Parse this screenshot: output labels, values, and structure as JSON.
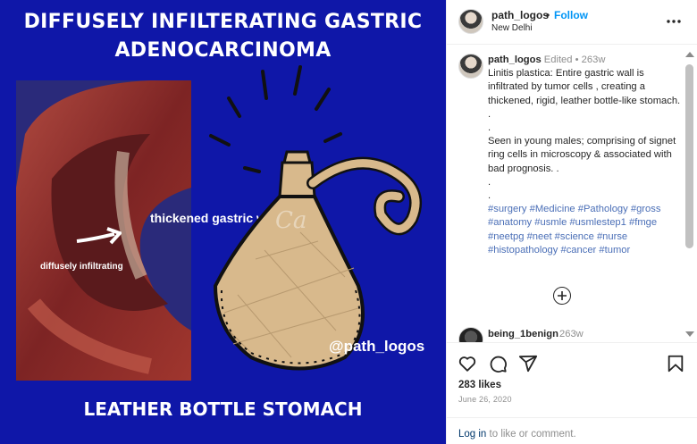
{
  "image": {
    "title_line1": "DIFFUSELY INFILTERATING GASTRIC",
    "title_line2": "ADENOCARCINOMA",
    "label_thickened": "thickened gastric wall",
    "label_diffuse": "diffusely infiltrating",
    "handle": "@path_logos",
    "footer": "LEATHER BOTTLE STOMACH",
    "watermark": "Ca",
    "colors": {
      "background": "#0f17a8",
      "bottle": "#d8b98c",
      "specimen": "#8b2a2a"
    }
  },
  "header": {
    "username": "path_logos",
    "dot": "•",
    "follow_label": "Follow",
    "location": "New Delhi",
    "more_icon": "more-horizontal-icon"
  },
  "caption": {
    "username": "path_logos",
    "edited": "Edited",
    "separator": "•",
    "age": "263w",
    "lines": [
      "Linitis plastica: Entire gastric wall  is infiltrated by tumor cells , creating a thickened, rigid, leather bottle-like stomach.",
      ".",
      ".",
      "Seen in young males; comprising of signet ring cells in microscopy & associated with bad prognosis. .",
      ".",
      "."
    ],
    "hashtags": [
      "#surgery",
      "#Medicine",
      "#Pathology",
      "#gross",
      "#anatomy",
      "#usmle",
      "#usmlestep1",
      "#fmge",
      "#neetpg",
      "#neet",
      "#science",
      "#nurse",
      "#histopathology",
      "#cancer",
      "#tumor"
    ]
  },
  "load_more_icon": "plus-circle-icon",
  "comment": {
    "username": "being_1benign",
    "age": "263w"
  },
  "actions": {
    "icons": [
      "heart-icon",
      "comment-icon",
      "share-icon",
      "bookmark-icon"
    ],
    "likes": "283 likes",
    "date": "June 26, 2020"
  },
  "login": {
    "link": "Log in",
    "rest": " to like or comment."
  },
  "colors": {
    "accent": "#0095f6",
    "hashtag": "#4b6fb7",
    "muted": "#8e8e8e"
  }
}
